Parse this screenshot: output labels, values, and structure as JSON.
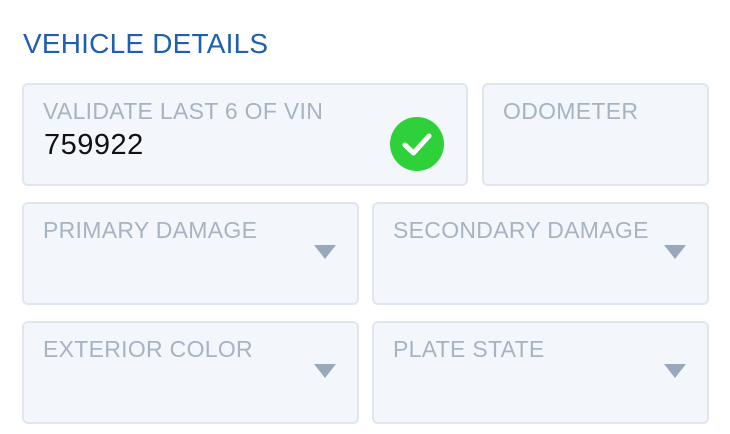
{
  "section": {
    "title": "VEHICLE DETAILS"
  },
  "fields": {
    "vin": {
      "label": "VALIDATE LAST 6 OF VIN",
      "value": "759922",
      "status_icon": "check-circle-icon",
      "status_color": "#2ed13a"
    },
    "odometer": {
      "label": "ODOMETER",
      "value": ""
    },
    "primary_damage": {
      "label": "PRIMARY DAMAGE",
      "icon": "caret-down-icon"
    },
    "secondary_damage": {
      "label": "SECONDARY DAMAGE",
      "icon": "caret-down-icon"
    },
    "exterior_color": {
      "label": "EXTERIOR COLOR",
      "icon": "caret-down-icon"
    },
    "plate_state": {
      "label": "PLATE STATE",
      "icon": "caret-down-icon"
    }
  },
  "colors": {
    "title": "#1e5fae",
    "field_background": "#f3f7fc",
    "field_border": "#dfe6ef",
    "label": "#a8b3c2",
    "caret": "#9aa8bb"
  }
}
